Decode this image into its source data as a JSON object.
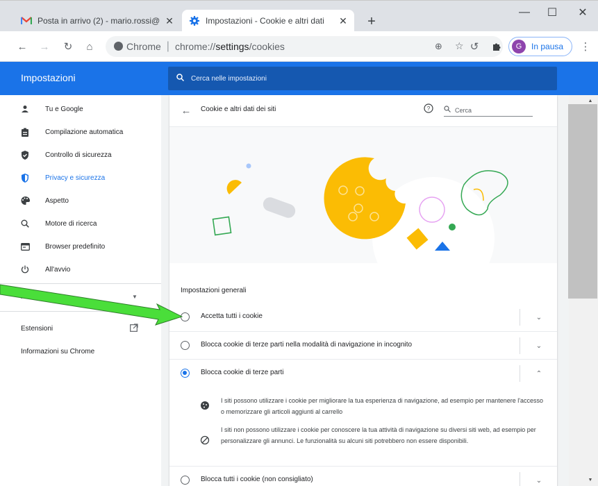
{
  "browser": {
    "tabs": [
      {
        "title": "Posta in arrivo (2) - mario.rossi@",
        "close": "✕"
      },
      {
        "title": "Impostazioni - Cookie e altri dati",
        "close": "✕"
      }
    ],
    "new_tab": "+",
    "window_controls": {
      "minimize": "—",
      "maximize": "☐",
      "close": "✕"
    },
    "omnibox": {
      "site": "Chrome",
      "url_prefix": "chrome://",
      "url_path": "settings",
      "url_suffix": "/cookies"
    },
    "profile": {
      "initial": "G",
      "status": "In pausa"
    }
  },
  "settings": {
    "title": "Impostazioni",
    "search_placeholder": "Cerca nelle impostazioni",
    "sidebar": {
      "items": [
        {
          "label": "Tu e Google"
        },
        {
          "label": "Compilazione automatica"
        },
        {
          "label": "Controllo di sicurezza"
        },
        {
          "label": "Privacy e sicurezza",
          "active": true
        },
        {
          "label": "Aspetto"
        },
        {
          "label": "Motore di ricerca"
        },
        {
          "label": "Browser predefinito"
        },
        {
          "label": "All'avvio"
        }
      ],
      "advanced": "Avanzate",
      "extensions": "Estensioni",
      "about": "Informazioni su Chrome"
    },
    "page": {
      "title": "Cookie e altri dati dei siti",
      "search_placeholder": "Cerca",
      "section_label": "Impostazioni generali",
      "options": [
        {
          "label": "Accetta tutti i cookie",
          "checked": false,
          "expanded": false
        },
        {
          "label": "Blocca cookie di terze parti nella modalità di navigazione in incognito",
          "checked": false,
          "expanded": false
        },
        {
          "label": "Blocca cookie di terze parti",
          "checked": true,
          "expanded": true
        },
        {
          "label": "Blocca tutti i cookie (non consigliato)",
          "checked": false,
          "expanded": false
        }
      ],
      "details": [
        "I siti possono utilizzare i cookie per migliorare la tua esperienza di navigazione, ad esempio per mantenere l'accesso o memorizzare gli articoli aggiunti al carrello",
        "I siti non possono utilizzare i cookie per conoscere la tua attività di navigazione su diversi siti web, ad esempio per personalizzare gli annunci. Le funzionalità su alcuni siti potrebbero non essere disponibili."
      ]
    }
  },
  "colors": {
    "accent": "#1a73e8",
    "annotation_arrow": "#4ade3a",
    "cookie": "#fbbc04"
  }
}
